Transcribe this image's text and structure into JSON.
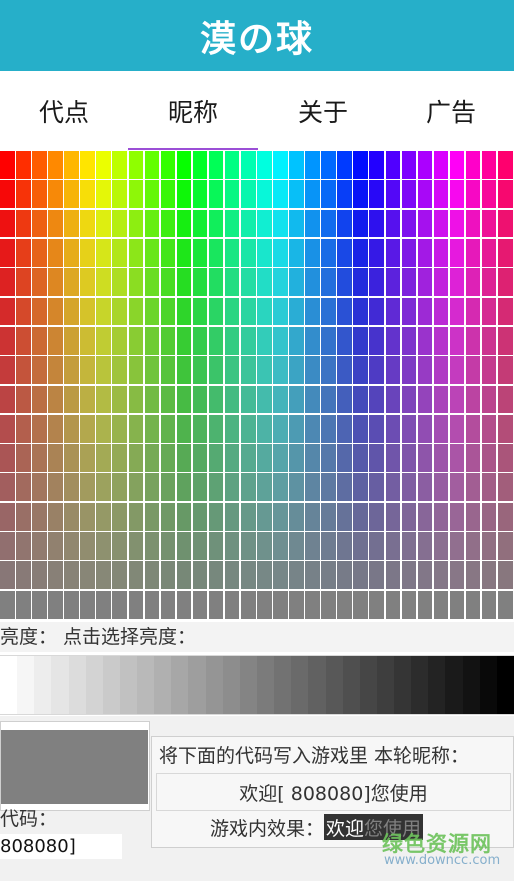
{
  "app": {
    "title": "漠の球"
  },
  "tabs": [
    {
      "label": "代点",
      "active": false
    },
    {
      "label": "昵称",
      "active": true
    },
    {
      "label": "关于",
      "active": false
    },
    {
      "label": "广告",
      "active": false
    }
  ],
  "palette": {
    "columns": 32,
    "rows": 16,
    "description_hues": "rainbow hue grid fading to gray"
  },
  "brightness": {
    "label": "亮度：  点击选择亮度：",
    "steps": 30
  },
  "selection": {
    "color": "#808080",
    "code_label": "代码：",
    "code_value": "808080]"
  },
  "info": {
    "instruction": "将下面的代码写入游戏里 本轮昵称：",
    "welcome": "欢迎[ 808080]您使用",
    "effect_label": "游戏内效果：",
    "effect_name": "欢迎",
    "effect_rest": " 您使用"
  },
  "watermark": {
    "logo": "绿色资源网",
    "url": "www.downcc.com"
  },
  "colors": {
    "accent": "#26afc9",
    "tab_indicator": "#9b4fd6",
    "selected_gray": "#808080"
  }
}
